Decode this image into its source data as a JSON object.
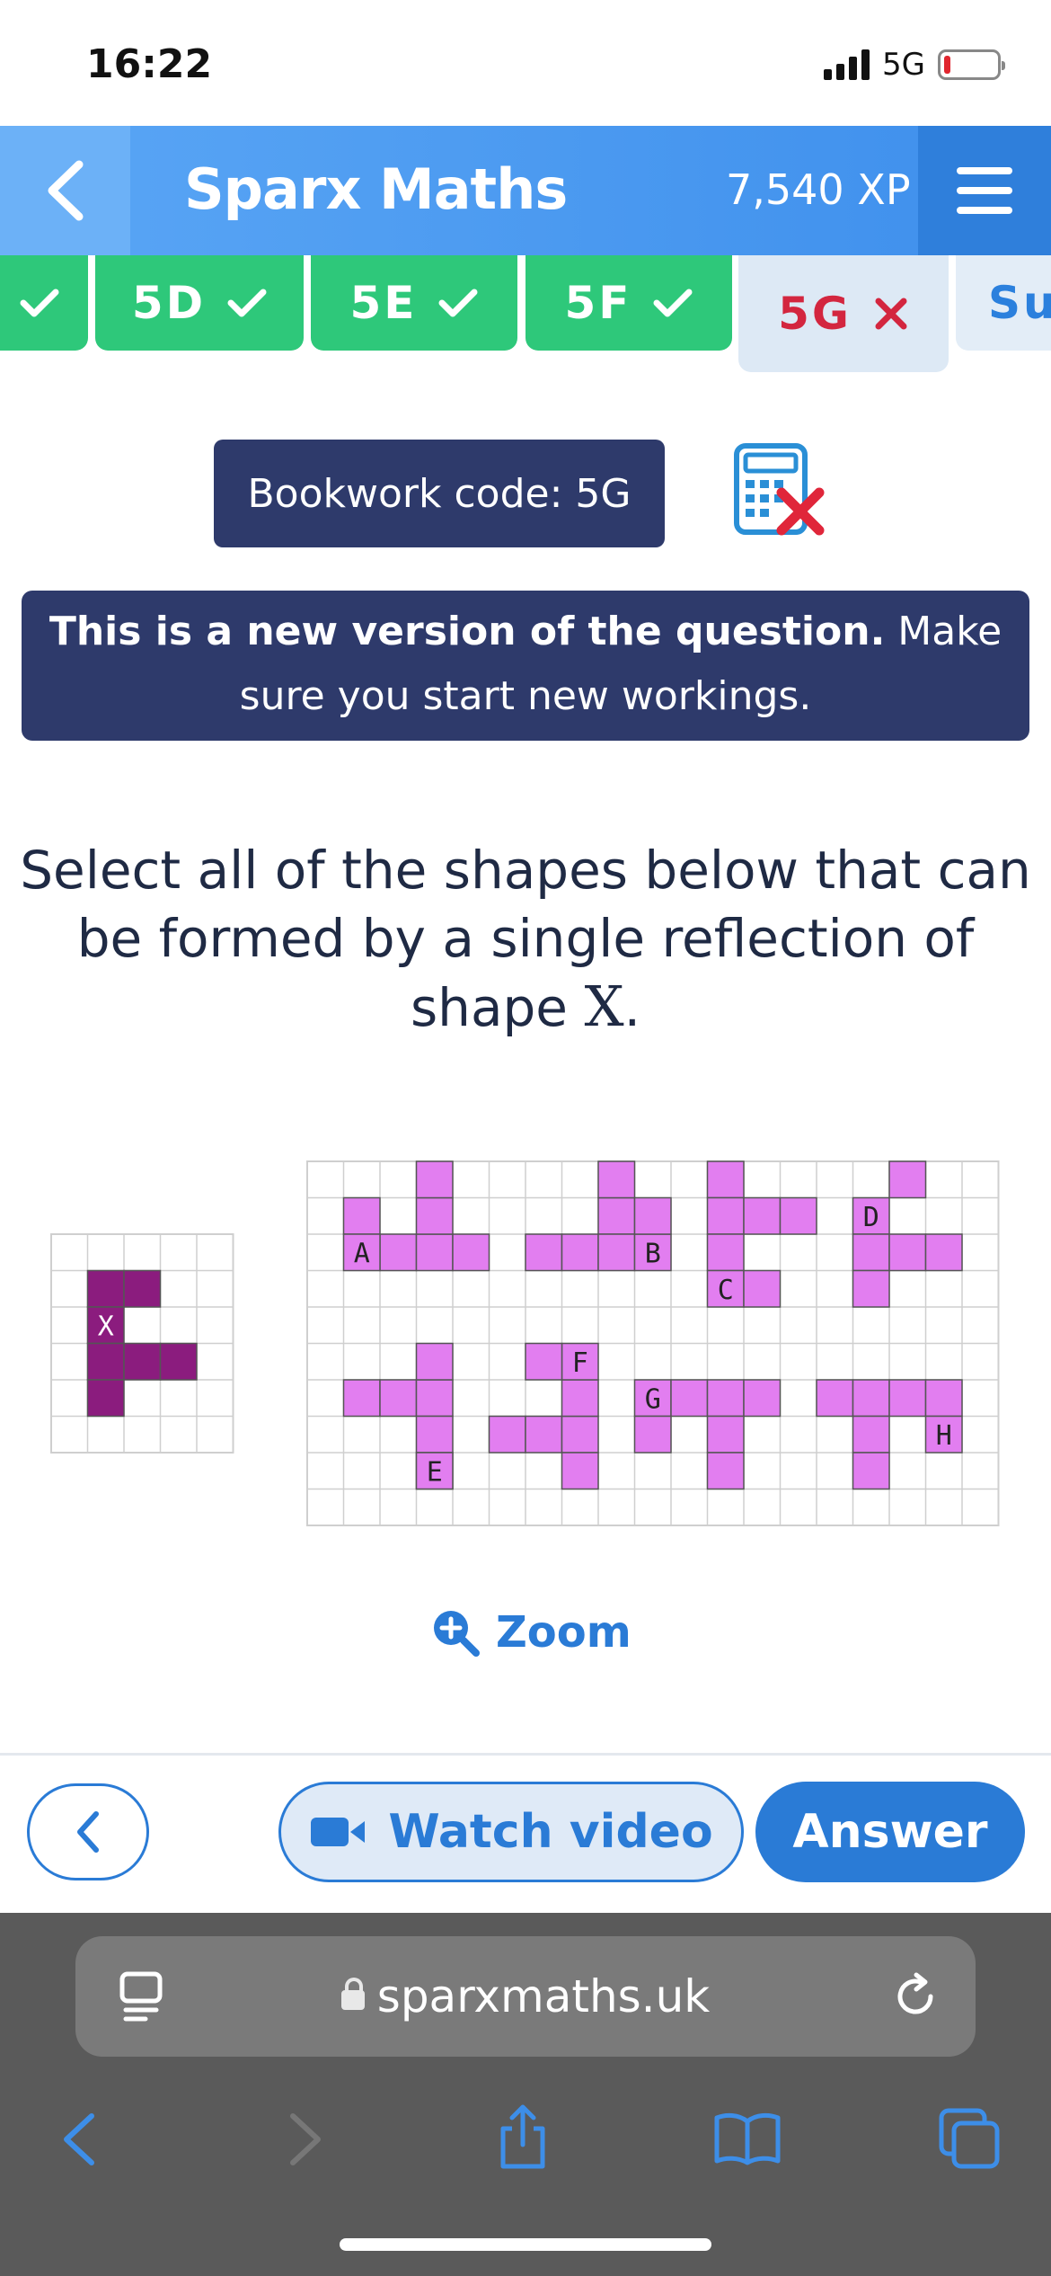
{
  "status": {
    "time": "16:22",
    "network": "5G"
  },
  "header": {
    "title": "Sparx Maths",
    "xp": "7,540 XP"
  },
  "tabs": [
    {
      "label": "",
      "state": "done"
    },
    {
      "label": "5D",
      "state": "done"
    },
    {
      "label": "5E",
      "state": "done"
    },
    {
      "label": "5F",
      "state": "done"
    },
    {
      "label": "5G",
      "state": "current-wrong"
    },
    {
      "label": "Su",
      "state": "next"
    }
  ],
  "bookwork": {
    "label": "Bookwork code: 5G"
  },
  "notice": {
    "bold": "This is a new version of the question.",
    "rest": " Make sure you start new workings."
  },
  "question": {
    "text": "Select all of the shapes below that can be formed by a single reflection of shape ",
    "shape": "X",
    "end": "."
  },
  "figure": {
    "reference_label": "X",
    "option_labels": [
      "A",
      "B",
      "C",
      "D",
      "E",
      "F",
      "G",
      "H"
    ],
    "colors": {
      "reference": "#8b1c7e",
      "options": "#e27ef0",
      "grid": "#cfcfcf"
    }
  },
  "zoom": {
    "label": "Zoom"
  },
  "buttons": {
    "watch_video": "Watch video",
    "answer": "Answer"
  },
  "browser": {
    "url": "sparxmaths.uk"
  },
  "colors": {
    "header": "#3e8fec",
    "tab_done": "#2ec87a",
    "navy": "#2e3a6b",
    "accent": "#2a7bd6",
    "wrong": "#d3263f"
  }
}
